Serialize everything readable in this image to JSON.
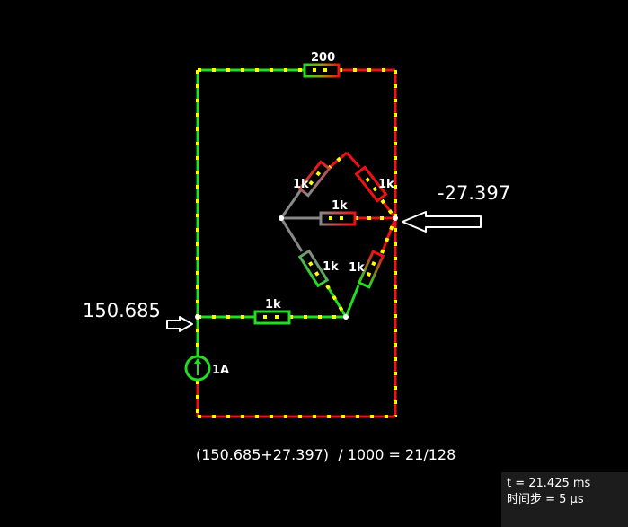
{
  "labels": {
    "top_resistor": "200",
    "upper_left_resistor": "1k",
    "upper_right_resistor": "1k",
    "middle_resistor": "1k",
    "lower_left_resistor": "1k",
    "lower_right_resistor": "1k",
    "bottom_resistor": "1k",
    "current_source": "1A"
  },
  "annotations": {
    "left_voltage": "150.685",
    "right_voltage": "-27.397",
    "formula": "(150.685+27.397)  / 1000 = 21/128"
  },
  "status": {
    "time": "t = 21.425 ms",
    "timestep": "时间步 = 5 μs"
  },
  "colors": {
    "background": "#000000",
    "wire_positive": "#22dd22",
    "wire_negative": "#ee1111",
    "wire_neutral": "#888888",
    "current_dot": "#ffff00",
    "node": "#ffffff",
    "arrow": "#ffffff"
  }
}
